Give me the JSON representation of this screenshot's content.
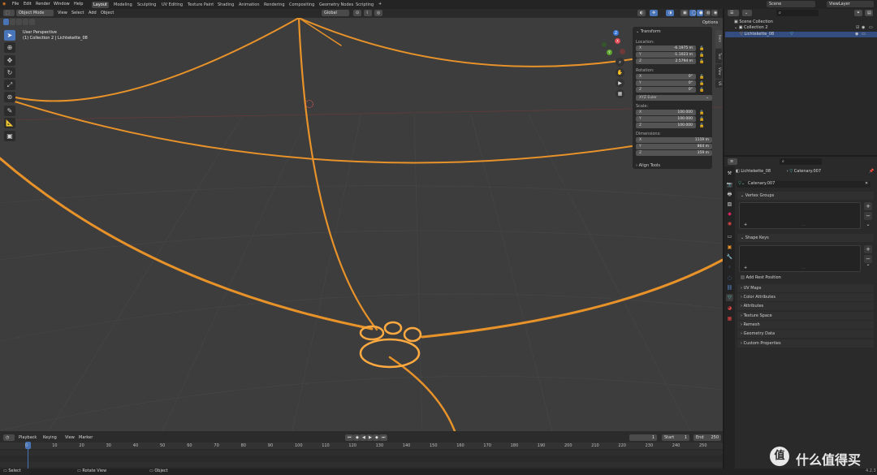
{
  "topbar": {
    "menus": [
      "File",
      "Edit",
      "Render",
      "Window",
      "Help"
    ],
    "workspaces": [
      "Layout",
      "Modeling",
      "Sculpting",
      "UV Editing",
      "Texture Paint",
      "Shading",
      "Animation",
      "Rendering",
      "Compositing",
      "Geometry Nodes",
      "Scripting"
    ],
    "active_workspace": "Layout",
    "add_tab": "+",
    "scene_label": "Scene",
    "viewlayer_label": "ViewLayer"
  },
  "viewport_header": {
    "mode": "Object Mode",
    "menus": [
      "View",
      "Select",
      "Add",
      "Object"
    ],
    "orientation": "Global",
    "options": "Options"
  },
  "overlay_text": {
    "perspective": "User Perspective",
    "context": "(1) Collection 2 | Lichtekette_08"
  },
  "gizmo": {
    "x": "X",
    "y": "Y",
    "z": "Z"
  },
  "npanel": {
    "title": "Transform",
    "location_label": "Location:",
    "location": [
      {
        "axis": "X",
        "value": "-6.1975 m"
      },
      {
        "axis": "Y",
        "value": "-1.1023 m"
      },
      {
        "axis": "Z",
        "value": "2.5794 m"
      }
    ],
    "rotation_label": "Rotation:",
    "rotation": [
      {
        "axis": "X",
        "value": "0°"
      },
      {
        "axis": "Y",
        "value": "0°"
      },
      {
        "axis": "Z",
        "value": "0°"
      }
    ],
    "rotation_mode": "XYZ Euler",
    "scale_label": "Scale:",
    "scale": [
      {
        "axis": "X",
        "value": "100.000"
      },
      {
        "axis": "Y",
        "value": "100.000"
      },
      {
        "axis": "Z",
        "value": "100.000"
      }
    ],
    "dimensions_label": "Dimensions:",
    "dimensions": [
      {
        "axis": "X",
        "value": "1119 m"
      },
      {
        "axis": "Y",
        "value": "864 m"
      },
      {
        "axis": "Z",
        "value": "359 m"
      }
    ],
    "align_tools": "Align Tools",
    "side_tabs": [
      "Item",
      "Tool",
      "View",
      "VR"
    ]
  },
  "outliner": {
    "search_placeholder": "",
    "scene_collection": "Scene Collection",
    "collection": "Collection 2",
    "object": "Lichtekette_08"
  },
  "properties": {
    "object_name": "Lichtekette_08",
    "data_name": "Catenary.007",
    "mesh_field": "Catenary.007",
    "sections": [
      "Vertex Groups",
      "Shape Keys",
      "UV Maps",
      "Color Attributes",
      "Attributes",
      "Texture Space",
      "Remesh",
      "Geometry Data",
      "Custom Properties"
    ],
    "add_rest_position": "Add Rest Position"
  },
  "timeline": {
    "menus": [
      "Playback",
      "Keying",
      "View",
      "Marker"
    ],
    "current_frame": "1",
    "start_label": "Start",
    "start": "1",
    "end_label": "End",
    "end": "250",
    "ticks": [
      "0",
      "10",
      "20",
      "30",
      "40",
      "50",
      "60",
      "70",
      "80",
      "90",
      "100",
      "110",
      "120",
      "130",
      "140",
      "150",
      "160",
      "170",
      "180",
      "190",
      "200",
      "210",
      "220",
      "230",
      "240",
      "250"
    ]
  },
  "statusbar": {
    "items": [
      "Select",
      "Rotate View",
      "Object"
    ],
    "version": "4.2.3"
  },
  "watermark": "值 什么值得买",
  "colors": {
    "accent": "#4a74b8",
    "selection": "#e8922a",
    "active_obj": "#ffaa40"
  }
}
